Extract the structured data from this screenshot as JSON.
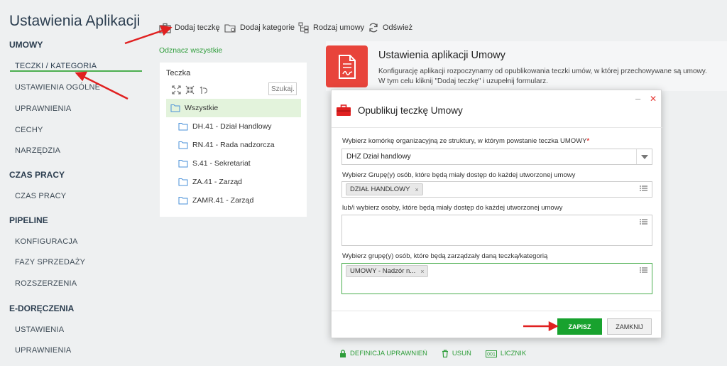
{
  "sidebar": {
    "title": "Ustawienia Aplikacji",
    "sections": [
      {
        "label": "UMOWY",
        "items": [
          "TECZKI / KATEGORIA",
          "USTAWIENIA OGÓLNE",
          "UPRAWNIENIA",
          "CECHY",
          "NARZĘDZIA"
        ]
      },
      {
        "label": "CZAS PRACY",
        "items": [
          "CZAS PRACY"
        ]
      },
      {
        "label": "PIPELINE",
        "items": [
          "KONFIGURACJA",
          "FAZY SPRZEDAŻY",
          "ROZSZERZENIA"
        ]
      },
      {
        "label": "E-DORĘCZENIA",
        "items": [
          "USTAWIENIA",
          "UPRAWNIENIA"
        ]
      }
    ],
    "active_item": "TECZKI / KATEGORIA"
  },
  "toolbar": {
    "add_folder": "Dodaj teczkę",
    "add_category": "Dodaj kategorie",
    "contract_type": "Rodzaj umowy",
    "refresh": "Odśwież"
  },
  "mark_all": "Odznacz wszystkie",
  "tree": {
    "title": "Teczka",
    "search_placeholder": "Szukaj...",
    "items": [
      "Wszystkie",
      "DH.41 - Dział Handlowy",
      "RN.41 - Rada nadzorcza",
      "S.41 - Sekretariat",
      "ZA.41 - Zarząd",
      "ZAMR.41 - Zarząd"
    ]
  },
  "banner": {
    "title": "Ustawienia aplikacji Umowy",
    "desc_line1": "Konfigurację aplikacji rozpoczynamy od opublikowania teczki umów, w której przechowywane są umowy.",
    "desc_line2": "W tym celu kliknij \"Dodaj teczkę\" i uzupełnij formularz."
  },
  "modal": {
    "title": "Opublikuj teczkę Umowy",
    "minimize": "–",
    "close": "✕",
    "field1_label": "Wybierz komórkę organizacyjną ze struktury, w którym powstanie teczka UMOWY",
    "field1_req": "*",
    "field1_value": "DHZ Dział handlowy",
    "field2_label": "Wybierz Grupę(y) osób, które będą miały dostęp do każdej utworzonej umowy",
    "field2_tag": "DZIAŁ HANDLOWY",
    "field3_label": "lub/i wybierz osoby, które będą miały dostęp do każdej utworzonej umowy",
    "field4_label": "Wybierz grupę(y) osób, które będą zarządzały daną teczką/kategorią",
    "field4_tag": "UMOWY - Nadzór n...",
    "tag_remove": "×",
    "save": "ZAPISZ",
    "close_btn": "ZAMKNIJ"
  },
  "bottom_links": {
    "permissions": "DEFINICJA UPRAWNIEŃ",
    "delete": "USUŃ",
    "counter": "LICZNIK"
  },
  "colors": {
    "accent_green": "#18a22e",
    "banner_red": "#e8443b",
    "annotation_red": "#e02020"
  }
}
